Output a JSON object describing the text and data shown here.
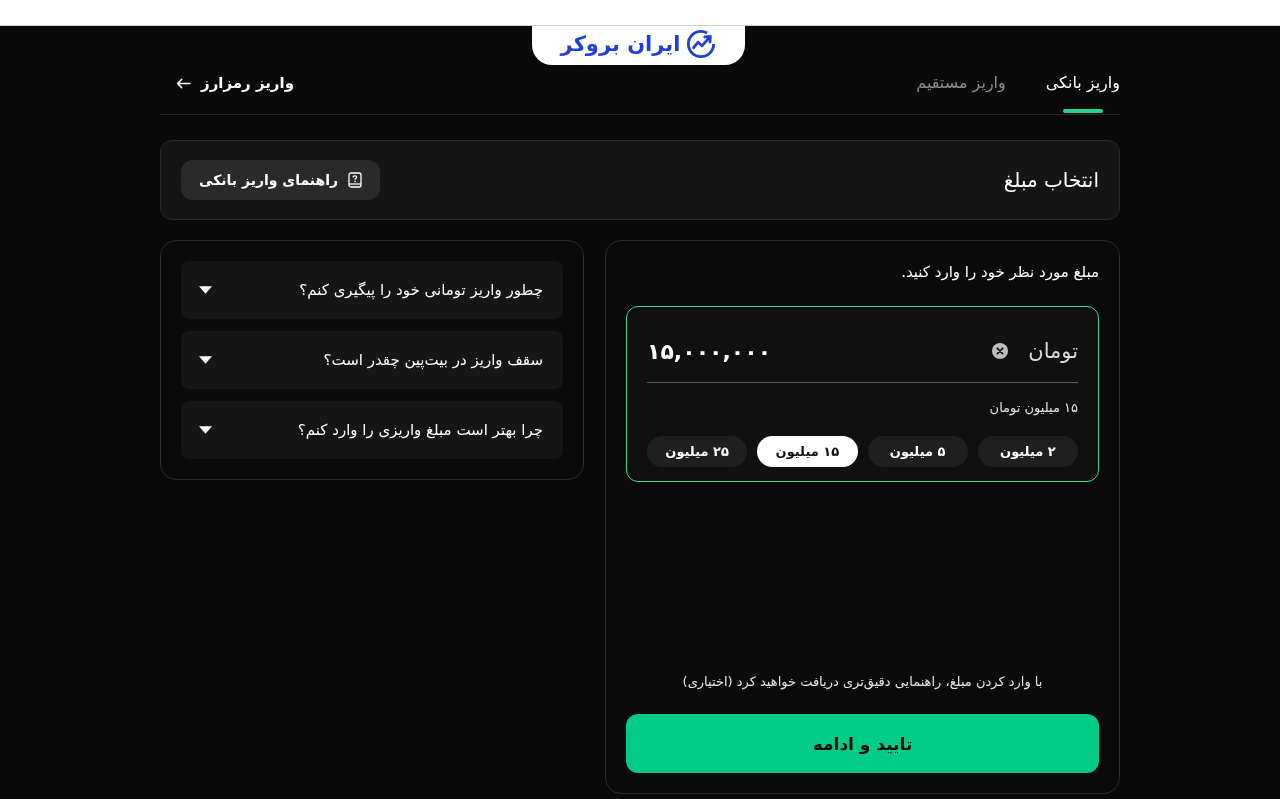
{
  "logo": {
    "text": "ایران بروکر"
  },
  "tabs": [
    {
      "label": "واریز بانکی",
      "selected": true
    },
    {
      "label": "واریز مستقیم",
      "selected": false
    }
  ],
  "crypto_link": {
    "label": "واریز رمزارز"
  },
  "header": {
    "title": "انتخاب مبلغ",
    "guide_button": "راهنمای واریز بانکی"
  },
  "amount_panel": {
    "prompt": "مبلغ مورد نظر خود را وارد کنید.",
    "currency": "تومان",
    "value": "۱۵,۰۰۰,۰۰۰",
    "amount_in_words": "۱۵ میلیون تومان",
    "presets": [
      {
        "label": "۲ میلیون",
        "selected": false
      },
      {
        "label": "۵ میلیون",
        "selected": false
      },
      {
        "label": "۱۵ میلیون",
        "selected": true
      },
      {
        "label": "۲۵ میلیون",
        "selected": false
      }
    ],
    "hint": "با وارد کردن مبلغ، راهنمایی دقیق‌تری دریافت خواهید کرد (اختیاری)",
    "confirm_button": "تایید و ادامه"
  },
  "faq": [
    {
      "question": "چطور واریز تومانی خود را پیگیری کنم؟",
      "expanded": false
    },
    {
      "question": "سقف واریز در بیت‌پین چقدر است؟",
      "expanded": false
    },
    {
      "question": "چرا بهتر است مبلغ واریزی را وارد کنم؟",
      "expanded": false
    }
  ]
}
